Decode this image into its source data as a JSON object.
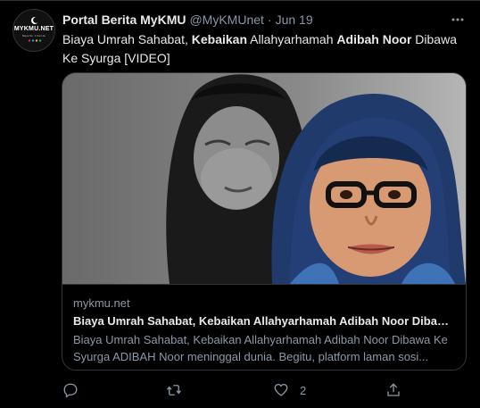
{
  "tweet": {
    "author": {
      "display_name": "Portal Berita MyKMU",
      "handle": "@MyKMUnet",
      "separator": "·",
      "date": "Jun 19",
      "avatar_text": "MYKMU.NET",
      "avatar_sub": "Maya No. 1 Kai Lite"
    },
    "text_parts": [
      {
        "t": "Biaya Umrah Sahabat, ",
        "bold": false
      },
      {
        "t": "Kebaikan",
        "bold": true
      },
      {
        "t": " Allahyarhamah ",
        "bold": false
      },
      {
        "t": "Adibah Noor",
        "bold": true
      },
      {
        "t": " Dibawa Ke Syurga [VIDEO]",
        "bold": false
      }
    ],
    "more_icon": "ellipsis-icon",
    "card": {
      "domain": "mykmu.net",
      "title": "Biaya Umrah Sahabat, Kebaikan Allahyarhamah Adibah Noor Dibawa ...",
      "description": "Biaya Umrah Sahabat, Kebaikan Allahyarhamah Adibah Noor Dibawa Ke Syurga ADIBAH Noor meninggal dunia. Begitu, platform laman sosi..."
    },
    "actions": {
      "reply_icon": "reply-icon",
      "retweet_icon": "retweet-icon",
      "like_icon": "heart-icon",
      "like_count": "2",
      "share_icon": "share-icon"
    }
  },
  "colors": {
    "background": "#000000",
    "text_primary": "#e7e9ea",
    "text_secondary": "#8b98a5",
    "border": "#2f3336"
  }
}
